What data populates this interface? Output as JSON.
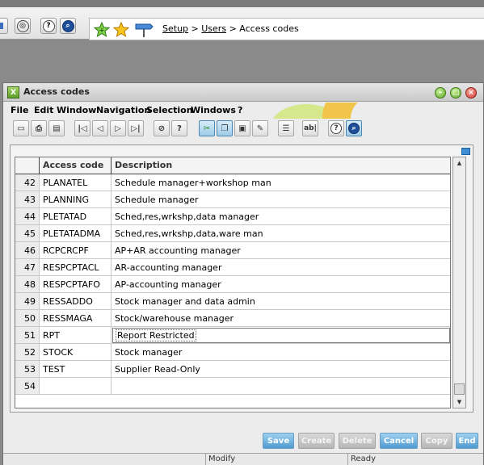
{
  "breadcrumb": {
    "setup": "Setup",
    "sep1": ">",
    "users": "Users",
    "sep2": ">",
    "current": "Access codes"
  },
  "icons": {
    "top_left": [
      "partial-icon",
      "zoom-circle-icon",
      "help-icon",
      "search-icon"
    ],
    "crumbs": [
      "favorite-add-icon",
      "favorites-icon",
      "signpost-icon"
    ]
  },
  "window": {
    "title": "Access codes",
    "app_icon_letter": "X"
  },
  "menu": [
    "File",
    "Edit",
    "Window",
    "Navigation",
    "Selection",
    "Windows",
    "?"
  ],
  "toolbar": [
    "new-icon",
    "print-icon",
    "print-preview-icon",
    "first-record-icon",
    "previous-record-icon",
    "next-record-icon",
    "last-record-icon",
    "attach-icon",
    "help-icon",
    "cut-icon",
    "copy-icon",
    "paste-icon",
    "sign-icon",
    "list-icon",
    "text-field-icon",
    "help-circle-icon",
    "search-icon"
  ],
  "grid": {
    "columns": [
      "Access code",
      "Description"
    ],
    "rows": [
      {
        "num": "42",
        "code": "PLANATEL",
        "desc": "Schedule manager+workshop man"
      },
      {
        "num": "43",
        "code": "PLANNING",
        "desc": "Schedule manager"
      },
      {
        "num": "44",
        "code": "PLETATAD",
        "desc": "Sched,res,wrkshp,data manager"
      },
      {
        "num": "45",
        "code": "PLETATADMA",
        "desc": "Sched,res,wrkshp,data,ware man"
      },
      {
        "num": "46",
        "code": "RCPCRCPF",
        "desc": "AP+AR accounting manager"
      },
      {
        "num": "47",
        "code": "RESPCPTACL",
        "desc": "AR-accounting manager"
      },
      {
        "num": "48",
        "code": "RESPCPTAFO",
        "desc": "AP-accounting manager"
      },
      {
        "num": "49",
        "code": "RESSADDO",
        "desc": "Stock manager and data admin"
      },
      {
        "num": "50",
        "code": "RESSMAGA",
        "desc": "Stock/warehouse manager"
      },
      {
        "num": "51",
        "code": "RPT",
        "desc": "Report Restricted"
      },
      {
        "num": "52",
        "code": "STOCK",
        "desc": "Stock manager"
      },
      {
        "num": "53",
        "code": "TEST",
        "desc": "Supplier Read-Only"
      },
      {
        "num": "54",
        "code": "",
        "desc": ""
      }
    ]
  },
  "actions": {
    "save": "Save",
    "create": "Create",
    "delete": "Delete",
    "cancel": "Cancel",
    "copy": "Copy",
    "end": "End"
  },
  "status": {
    "mode": "Modify",
    "state": "Ready"
  },
  "colors": {
    "accent_blue": "#4f9bd0",
    "disabled_gray": "#b7b7b7",
    "title_green": "#5c9e26"
  }
}
